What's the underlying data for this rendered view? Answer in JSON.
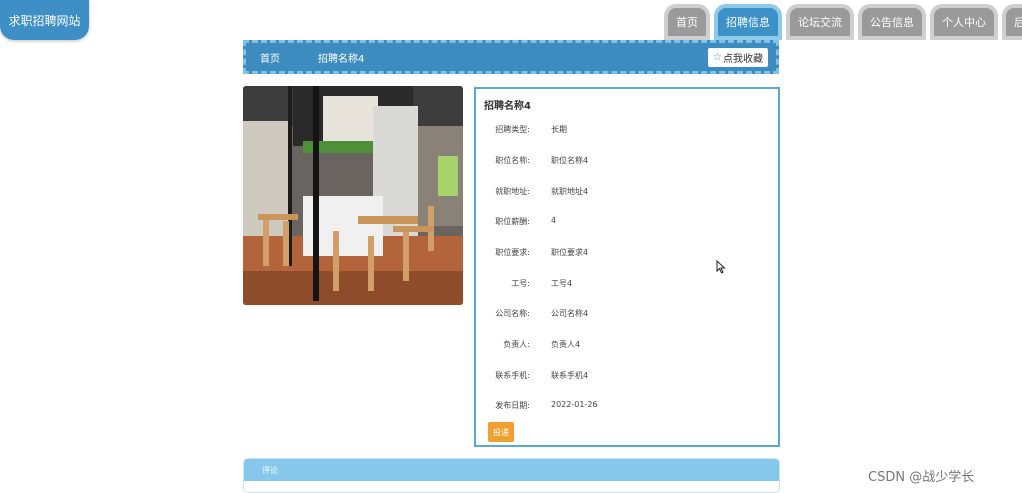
{
  "site": {
    "title": "求职招聘网站"
  },
  "nav": {
    "items": [
      {
        "label": "首页",
        "active": false
      },
      {
        "label": "招聘信息",
        "active": true
      },
      {
        "label": "论坛交流",
        "active": false
      },
      {
        "label": "公告信息",
        "active": false
      },
      {
        "label": "个人中心",
        "active": false
      },
      {
        "label": "后台管理",
        "active": false
      }
    ]
  },
  "breadcrumb": {
    "home": "首页",
    "current": "招聘名称4"
  },
  "favorite": {
    "icon": "star-icon",
    "label": "点我收藏"
  },
  "detail": {
    "title": "招聘名称4",
    "fields": [
      {
        "label": "招聘类型:",
        "value": "长期"
      },
      {
        "label": "职位名称:",
        "value": "职位名称4"
      },
      {
        "label": "就职地址:",
        "value": "就职地址4"
      },
      {
        "label": "职位薪酬:",
        "value": "4"
      },
      {
        "label": "职位要求:",
        "value": "职位要求4"
      },
      {
        "label": "工号:",
        "value": "工号4"
      },
      {
        "label": "公司名称:",
        "value": "公司名称4"
      },
      {
        "label": "负责人:",
        "value": "负责人4"
      },
      {
        "label": "联系手机:",
        "value": "联系手机4"
      },
      {
        "label": "发布日期:",
        "value": "2022-01-26"
      }
    ],
    "apply_label": "投递"
  },
  "comment": {
    "title": "评论"
  },
  "watermark": "CSDN @战少学长",
  "colors": {
    "primary": "#3d8cc0",
    "accent": "#f0a030",
    "tab_inactive": "#9a9a9a"
  }
}
